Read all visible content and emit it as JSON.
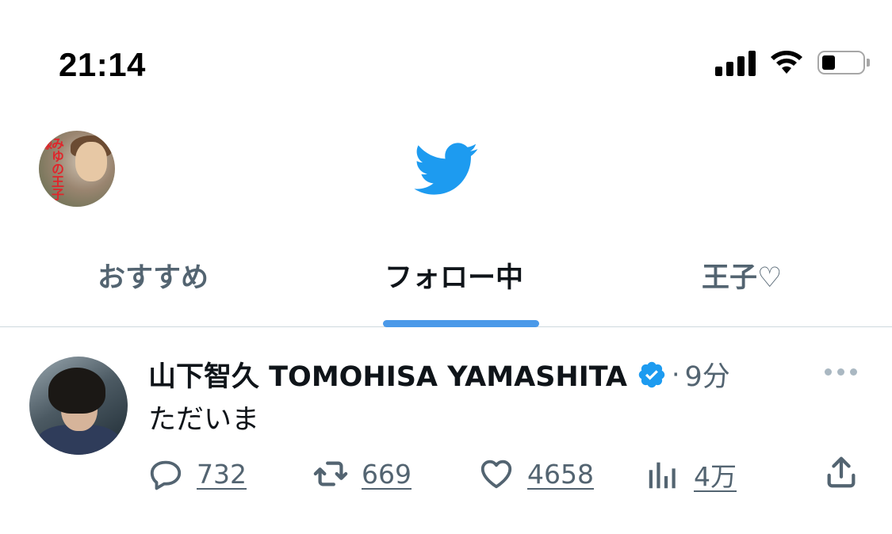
{
  "status_bar": {
    "time": "21:14"
  },
  "header": {
    "avatar_text": "みゆの王子様",
    "logo_icon": "twitter-bird-icon"
  },
  "tabs": [
    {
      "label": "おすすめ",
      "active": false
    },
    {
      "label": "フォロー中",
      "active": true
    },
    {
      "label": "王子♡",
      "active": false
    }
  ],
  "tweet": {
    "display_name": "山下智久 TOMOHISA YAMASHITA",
    "verified": true,
    "separator": "·",
    "time": "9分",
    "text": "ただいま",
    "actions": {
      "reply_count": "732",
      "retweet_count": "669",
      "like_count": "4658",
      "views_count": "4万"
    }
  },
  "colors": {
    "accent": "#4a99e9",
    "twitter_blue": "#1d9bf0",
    "muted_text": "#536471",
    "primary_text": "#0f1419"
  }
}
